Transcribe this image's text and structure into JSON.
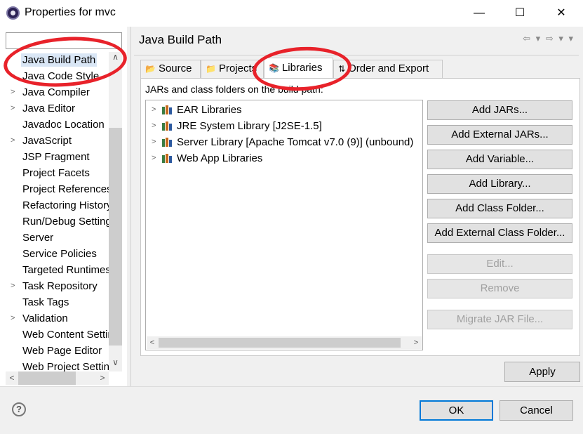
{
  "window": {
    "title": "Properties for mvc",
    "minimize_glyph": "—",
    "maximize_glyph": "☐",
    "close_glyph": "✕"
  },
  "sidebar": {
    "filter_placeholder": "",
    "items": [
      {
        "label": "Java Build Path",
        "expandable": false,
        "selected": true
      },
      {
        "label": "Java Code Style",
        "expandable": true
      },
      {
        "label": "Java Compiler",
        "expandable": true
      },
      {
        "label": "Java Editor",
        "expandable": true
      },
      {
        "label": "Javadoc Location",
        "expandable": false
      },
      {
        "label": "JavaScript",
        "expandable": true
      },
      {
        "label": "JSP Fragment",
        "expandable": false
      },
      {
        "label": "Project Facets",
        "expandable": false
      },
      {
        "label": "Project References",
        "expandable": false
      },
      {
        "label": "Refactoring History",
        "expandable": false
      },
      {
        "label": "Run/Debug Settings",
        "expandable": false
      },
      {
        "label": "Server",
        "expandable": false
      },
      {
        "label": "Service Policies",
        "expandable": false
      },
      {
        "label": "Targeted Runtimes",
        "expandable": false
      },
      {
        "label": "Task Repository",
        "expandable": true
      },
      {
        "label": "Task Tags",
        "expandable": false
      },
      {
        "label": "Validation",
        "expandable": true
      },
      {
        "label": "Web Content Settings",
        "expandable": false
      },
      {
        "label": "Web Page Editor",
        "expandable": false
      },
      {
        "label": "Web Project Settings",
        "expandable": false
      }
    ]
  },
  "page": {
    "title": "Java Build Path",
    "nav_back": "⇦ ▾",
    "nav_forward": "⇨ ▾",
    "menu": "▾"
  },
  "tabs": [
    {
      "label": "Source",
      "icon": "source-folder-icon",
      "active": false
    },
    {
      "label": "Projects",
      "icon": "projects-icon",
      "active": false
    },
    {
      "label": "Libraries",
      "icon": "libraries-icon",
      "active": true
    },
    {
      "label": "Order and Export",
      "icon": "order-export-icon",
      "active": false
    }
  ],
  "libraries": {
    "description": "JARs and class folders on the build path:",
    "items": [
      {
        "label": "EAR Libraries"
      },
      {
        "label": "JRE System Library [J2SE-1.5]"
      },
      {
        "label": "Server Library [Apache Tomcat v7.0 (9)] (unbound)"
      },
      {
        "label": "Web App Libraries"
      }
    ]
  },
  "buttons": {
    "add_jars": "Add JARs...",
    "add_external_jars": "Add External JARs...",
    "add_variable": "Add Variable...",
    "add_library": "Add Library...",
    "add_class_folder": "Add Class Folder...",
    "add_external_class_folder": "Add External Class Folder...",
    "edit": "Edit...",
    "remove": "Remove",
    "migrate_jar": "Migrate JAR File...",
    "apply": "Apply",
    "ok": "OK",
    "cancel": "Cancel",
    "help": "?"
  },
  "annotation_color": "#e8222a"
}
